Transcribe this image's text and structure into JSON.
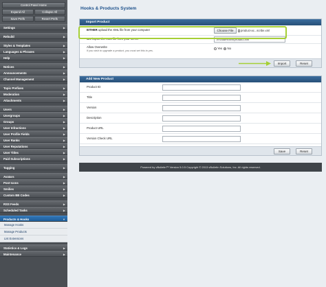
{
  "sidebar": {
    "control_panel_home": "Control Panel Home",
    "expand_all": "Expand All",
    "collapse_all": "Collapse All",
    "save_prefs": "Save Prefs",
    "revert_prefs": "Revert Prefs",
    "groups": [
      [
        "Settings"
      ],
      [
        "Rebuild"
      ],
      [
        "Styles & Templates",
        "Languages & Phrases",
        "Help"
      ],
      [
        "Notices",
        "Announcements",
        "Channel Management"
      ],
      [
        "Topic Prefixes",
        "Moderation",
        "Attachments"
      ],
      [
        "Users",
        "Usergroups",
        "Groups",
        "User Infractions",
        "User Profile Fields",
        "User Ranks",
        "User Reputations",
        "User Titles",
        "Paid Subscriptions"
      ],
      [
        "Tagging"
      ],
      [
        "Avatars",
        "Post Icons",
        "Smilies",
        "Custom BB Codes"
      ],
      [
        "RSS Feeds",
        "Scheduled Tasks"
      ]
    ],
    "active_item": "Products & Hooks",
    "sub_items": [
      "Manage Hooks",
      "Manage Products",
      "List Extensions"
    ],
    "bottom_items": [
      "Statistics & Logs",
      "Maintenance"
    ]
  },
  "page_title": "Hooks & Products System",
  "import_panel": {
    "title": "Import Product",
    "either_prefix": "EITHER",
    "either_text": " upload the XML file from your computer",
    "choose_file": "Choose File",
    "file_name": "product-ac...scribe.xml",
    "or_prefix": "OR",
    "or_text": " import the XML file from your server",
    "server_path": "./includes/xml/product.xml",
    "allow_overwrite_label": "Allow Overwrite",
    "allow_overwrite_desc": "If you wish to upgrade a product, you must set this to yes.",
    "yes_label": "Yes",
    "no_label": "No",
    "import_button": "Import",
    "reset_button": "Reset"
  },
  "add_panel": {
    "title": "Add New Product",
    "fields": [
      "Product ID",
      "Title",
      "Version",
      "Description",
      "Product URL",
      "Version Check URL"
    ],
    "save_button": "Save",
    "reset_button": "Reset"
  },
  "footer": {
    "text": "Powered by vBulletin™ Version 5.0.5 Copyright © 2013 vBulletin Solutions, Inc. All rights reserved."
  },
  "colors": {
    "accent": "#1b4f8a",
    "highlight": "#a5cf34",
    "panel_head": "#2f5f8e",
    "sidebar": "#4a4e53",
    "active": "#2468a8"
  },
  "icons": {
    "submenu_arrow": "chevron-right-icon",
    "active_arrow": "chevron-down-icon"
  }
}
